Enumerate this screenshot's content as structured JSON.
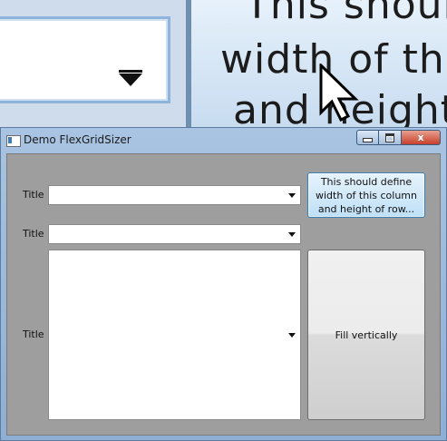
{
  "background": {
    "zoom_lines": [
      "This should",
      "width of this",
      "and height"
    ]
  },
  "window": {
    "title": "Demo FlexGridSizer",
    "buttons": {
      "close": "x"
    }
  },
  "rows": [
    {
      "label": "Title",
      "combo_value": ""
    },
    {
      "label": "Title",
      "combo_value": ""
    },
    {
      "label": "Title",
      "combo_value": ""
    }
  ],
  "buttons": {
    "define": "This should define width of this column and height of row...",
    "fill": "Fill vertically"
  },
  "colors": {
    "client_bg": "#9e9e9e",
    "close_button": "#c7402a",
    "define_button": "#bfe0f7"
  },
  "icons": [
    "app-icon",
    "dropdown-arrow-icon",
    "minimize-icon",
    "maximize-icon",
    "close-icon",
    "mouse-cursor-icon"
  ]
}
